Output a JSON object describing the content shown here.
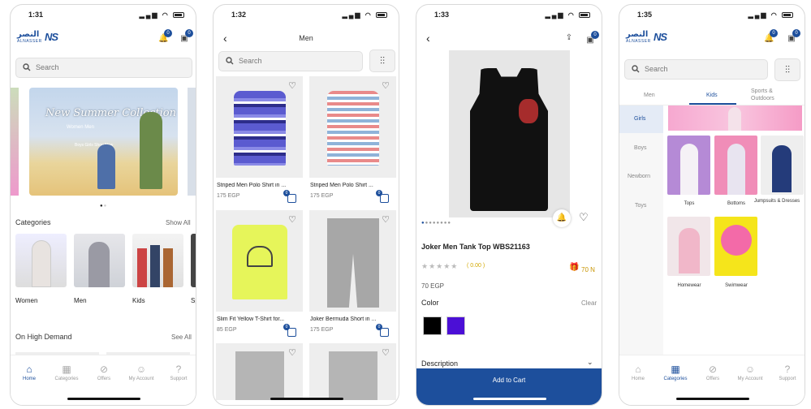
{
  "colors": {
    "brand": "#1d4f9c",
    "add_to_cart_bg": "#1d4f9c"
  },
  "phones": {
    "home": {
      "time": "1:31",
      "logo_ar": "النصر",
      "logo_en": "ALNASSER",
      "logo_mark": "NS",
      "notif_badge": "0",
      "cart_badge": "0",
      "search_placeholder": "Search",
      "banner": {
        "line1": "New Summer Collection",
        "line2": "Women Men",
        "line3": "Boys Girls Shop Now"
      },
      "categories_title": "Categories",
      "show_all": "Show All",
      "categories": [
        "Women",
        "Men",
        "Kids",
        "Sp"
      ],
      "high_demand_title": "On High Demand",
      "see_all": "See All",
      "tabs": [
        "Home",
        "Categories",
        "Offers",
        "My Account",
        "Support"
      ]
    },
    "men": {
      "time": "1:32",
      "title": "Men",
      "search_placeholder": "Search",
      "products": [
        {
          "name": "Striped Men Polo Shirt in ...",
          "price": "175 EGP",
          "cart_badge": "0"
        },
        {
          "name": "Striped Men Polo Shirt ...",
          "price": "175 EGP",
          "cart_badge": "0"
        },
        {
          "name": "Slim Fit Yellow T-Shirt for...",
          "price": "85 EGP",
          "cart_badge": "0"
        },
        {
          "name": "Joker Bermuda Short in ...",
          "price": "175 EGP",
          "cart_badge": "0"
        }
      ]
    },
    "product": {
      "time": "1:33",
      "cart_badge": "0",
      "name": "Joker Men Tank Top WBS21163",
      "rating": "( 0.00 )",
      "points": "70 N",
      "price": "70 EGP",
      "color_label": "Color",
      "clear_label": "Clear",
      "swatches": [
        "#000000",
        "#4b0fd6"
      ],
      "description_label": "Description",
      "add_to_cart": "Add to Cart"
    },
    "kids": {
      "time": "1:35",
      "notif_badge": "0",
      "cart_badge": "0",
      "search_placeholder": "Search",
      "top_tabs": [
        "Men",
        "Kids",
        "Sports & Outdoors"
      ],
      "side_cats": [
        "Girls",
        "Boys",
        "Newborn",
        "Toys"
      ],
      "subcats": [
        "Tops",
        "Bottoms",
        "Jumpsuits & Dresses",
        "Homewear",
        "Swimwear"
      ],
      "tabs": [
        "Home",
        "Categories",
        "Offers",
        "My Account",
        "Support"
      ]
    }
  }
}
